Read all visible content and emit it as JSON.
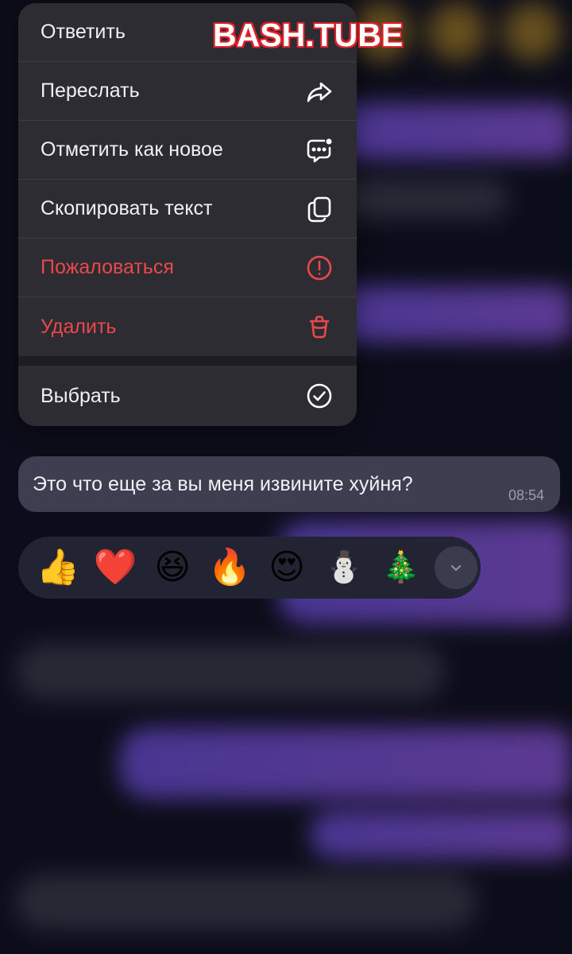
{
  "watermark": {
    "part1": "BASH",
    "part2": ".TUBE"
  },
  "menu": {
    "items": [
      {
        "label": "Ответить",
        "icon": "reply-icon",
        "danger": false
      },
      {
        "label": "Переслать",
        "icon": "forward-icon",
        "danger": false
      },
      {
        "label": "Отметить как новое",
        "icon": "mark-unread-icon",
        "danger": false
      },
      {
        "label": "Скопировать текст",
        "icon": "copy-icon",
        "danger": false
      },
      {
        "label": "Пожаловаться",
        "icon": "report-icon",
        "danger": true
      },
      {
        "label": "Удалить",
        "icon": "trash-icon",
        "danger": true
      }
    ],
    "select": {
      "label": "Выбрать",
      "icon": "checkmark-circle-icon"
    }
  },
  "message": {
    "text": "Это что еще за вы меня извините хуйня?",
    "time": "08:54"
  },
  "reactions": [
    {
      "name": "thumbs-up-emoji",
      "glyph": "👍"
    },
    {
      "name": "heart-emoji",
      "glyph": "❤️"
    },
    {
      "name": "laughing-emoji",
      "glyph": "😆"
    },
    {
      "name": "fire-emoji",
      "glyph": "🔥"
    },
    {
      "name": "heart-eyes-emoji",
      "glyph": "😍"
    },
    {
      "name": "snowman-emoji",
      "glyph": "⛄"
    },
    {
      "name": "christmas-tree-emoji",
      "glyph": "🎄"
    }
  ],
  "colors": {
    "menu_bg": "#2c2c32",
    "danger": "#e9494c",
    "bubble_bg": "#3d3e50",
    "accent_purple": "#7a52d8"
  }
}
